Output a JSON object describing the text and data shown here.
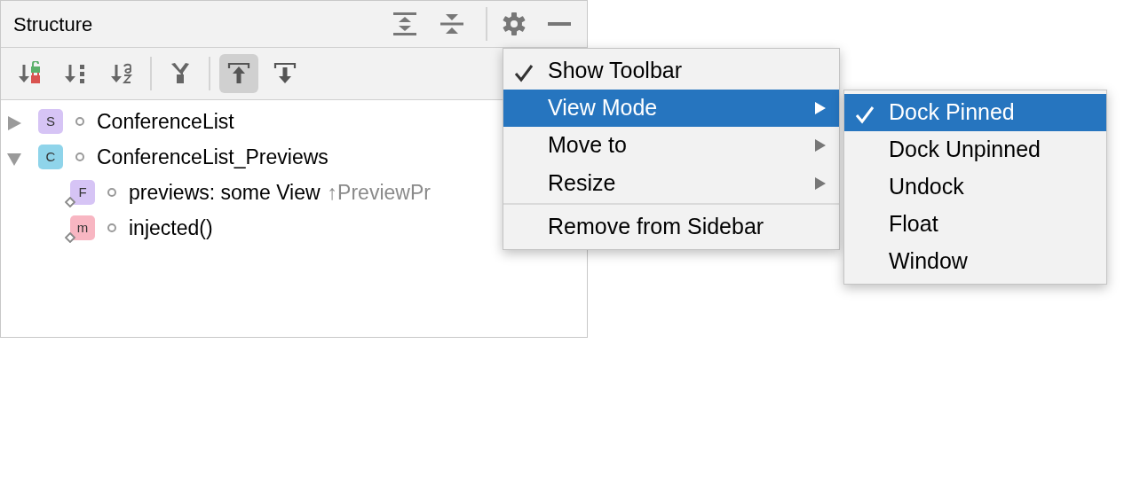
{
  "panel": {
    "title": "Structure",
    "toolbar": [
      [
        {
          "kind": "sort-visibility",
          "selected": false
        },
        {
          "kind": "sort-type",
          "selected": false
        },
        {
          "kind": "sort-alpha",
          "selected": false
        }
      ],
      [
        {
          "kind": "merge",
          "selected": false
        }
      ],
      [
        {
          "kind": "scroll-from",
          "selected": true
        },
        {
          "kind": "scroll-to",
          "selected": false
        }
      ]
    ],
    "tree": [
      {
        "badge": "S",
        "color": "#d6c4f5",
        "label": "ConferenceList",
        "expanded": false
      },
      {
        "badge": "C",
        "color": "#8fd4ea",
        "label": "ConferenceList_Previews",
        "expanded": true,
        "children": [
          {
            "badge": "F",
            "color": "#d6c4f5",
            "label": "previews: some View",
            "inherited": "↑PreviewPr"
          },
          {
            "badge": "m",
            "color": "#f8b6c2",
            "label": "injected()"
          }
        ]
      }
    ]
  },
  "menu": [
    {
      "label": "Show Toolbar",
      "checked": true,
      "selected": false,
      "submenu": false
    },
    {
      "label": "View Mode",
      "checked": false,
      "selected": true,
      "submenu": true
    },
    {
      "label": "Move to",
      "checked": false,
      "selected": false,
      "submenu": true
    },
    {
      "label": "Resize",
      "checked": false,
      "selected": false,
      "submenu": true,
      "separator_after": true
    },
    {
      "label": "Remove from Sidebar",
      "checked": false,
      "selected": false,
      "submenu": false
    }
  ],
  "submenu": [
    {
      "label": "Dock Pinned",
      "checked": true,
      "selected": true
    },
    {
      "label": "Dock Unpinned",
      "checked": false,
      "selected": false
    },
    {
      "label": "Undock",
      "checked": false,
      "selected": false
    },
    {
      "label": "Float",
      "checked": false,
      "selected": false
    },
    {
      "label": "Window",
      "checked": false,
      "selected": false
    }
  ]
}
